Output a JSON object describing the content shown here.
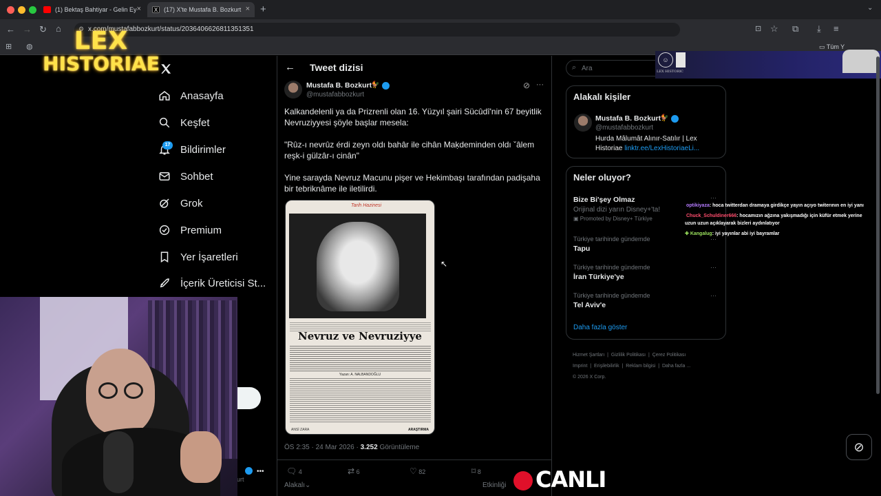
{
  "browser": {
    "tabs": [
      {
        "title": "(1) Bektaş Bahtiyar - Gelin Ey"
      },
      {
        "title": "(17) X'te Mustafa B. Bozkurt"
      }
    ],
    "url": "x.com/mustafabbozkurt/status/2036406626811351351",
    "bookmarks_right": "Tüm Y"
  },
  "overlay": {
    "logo_line1": "LEX",
    "logo_line2": "HISTORIAE",
    "live_label": "CANLI",
    "small_logo_text": "LEX HISTORIC"
  },
  "sidebar": {
    "items": [
      {
        "label": "Anasayfa",
        "icon": "home-icon"
      },
      {
        "label": "Keşfet",
        "icon": "search-icon"
      },
      {
        "label": "Bildirimler",
        "icon": "bell-icon",
        "badge": "17"
      },
      {
        "label": "Sohbet",
        "icon": "mail-icon"
      },
      {
        "label": "Grok",
        "icon": "grok-icon"
      },
      {
        "label": "Premium",
        "icon": "verified-icon"
      },
      {
        "label": "Yer İşaretleri",
        "icon": "bookmark-icon"
      },
      {
        "label": "İçerik Üreticisi St...",
        "icon": "rocket-icon"
      }
    ],
    "account_handle_fragment": "urt"
  },
  "thread": {
    "header": "Tweet dizisi",
    "author_name": "Mustafa B. Bozkurt",
    "author_handle": "@mustafabbozkurt",
    "paragraph1": "Kalkandelenli ya da Prizrenli olan 16. Yüzyıl şairi Sücûdî'nin 67 beyitlik Nevruziyyesi şöyle başlar mesela:",
    "paragraph2": "\"Rûz-ı nevrûz érdi zeyn oldı bahâr ile cihân  Maḳdeminden oldı ˇâlem reşk-i gülzâr-ı cinân\"",
    "paragraph3": "Yine sarayda Nevruz Macunu pişer ve Hekimbaşı tarafından padişaha bir tebriknâme ile iletilirdi.",
    "image": {
      "handwritten": "Tarih Hazinesi",
      "headline": "Nevruz ve Nevruziyye",
      "byline": "Yazan: A. NALBANDOĞLU",
      "footer": "ARAŞTIRMA",
      "stamp": "ANSİ ZARA"
    },
    "timestamp": "ÖS 2:35 · 24 Mar 2026 · ",
    "views": "3.252",
    "views_label": "Görüntüleme",
    "stats": {
      "replies": "4",
      "retweets": "6",
      "likes": "82",
      "bookmarks": "8"
    },
    "bottom_tabs": [
      "Alakalı",
      "Etkinliği"
    ]
  },
  "right": {
    "search_placeholder": "Ara",
    "related_title": "Alakalı kişiler",
    "related_name": "Mustafa B. Bozkurt",
    "related_handle": "@mustafabbozkurt",
    "related_bio": "Hurda Mâlumât Alınır-Satılır | Lex Historiae ",
    "related_link": "linktr.ee/LexHistoriaeLi...",
    "whats_title": "Neler oluyor?",
    "promo_title": "Bize Bi'şey Olmaz",
    "promo_sub": "Orijinal dizi yarın Disney+'ta!",
    "promo_label": "Promoted by Disney+ Türkiye",
    "trends": [
      {
        "category": "Türkiye tarihinde gündemde",
        "name": "Tapu"
      },
      {
        "category": "Türkiye tarihinde gündemde",
        "name": "İran Türkiye'ye"
      },
      {
        "category": "Türkiye tarihinde gündemde",
        "name": "Tel Aviv'e"
      }
    ],
    "show_more": "Daha fazla göster",
    "footer_links": [
      "Hizmet Şartları",
      "Gizlilik Politikası",
      "Çerez Politikası",
      "Imprint",
      "Erişilebilirlik",
      "Reklam bilgisi",
      "Daha fazla ..."
    ],
    "copyright": "© 2026 X Corp."
  },
  "chat": [
    {
      "user": "optikiyaza",
      "user_color": "#b57bff",
      "text": ": hoca twitterdan dramaya girdikçe yayın açıyo twiterının en iyi yanı"
    },
    {
      "user": "Chuck_Schuldiner666",
      "user_color": "#ff4d6d",
      "text": ": hocamızın ağzına yakışmadığı için küfür etmek yerine"
    },
    {
      "user": "",
      "user_color": "#ffffff",
      "text": "uzun uzun açıklayarak bizleri aydınlatıyor"
    },
    {
      "user": "Kangalug",
      "user_color": "#9be15d",
      "text": ": iyi yayınlar abi iyi bayramlar"
    }
  ],
  "colors": {
    "accent": "#1d9bf0",
    "live_red": "#e0102a",
    "logo_yellow": "#ffe24a"
  }
}
